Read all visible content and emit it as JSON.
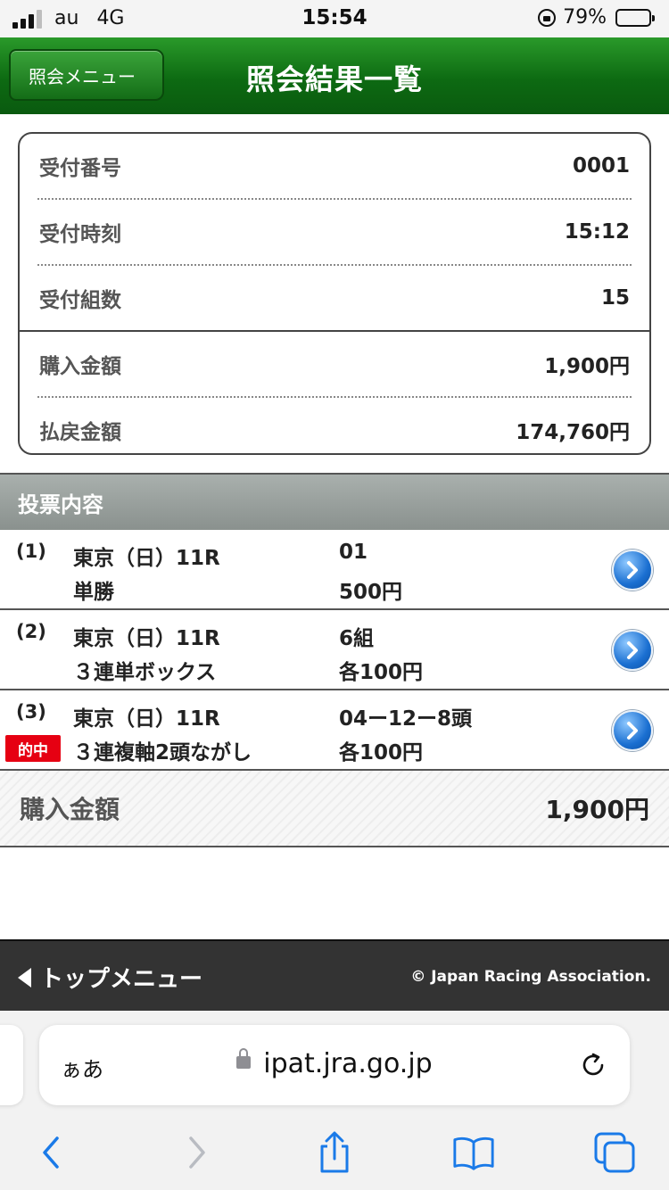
{
  "status_bar": {
    "carrier": "au",
    "network": "4G",
    "time": "15:54",
    "battery": "79%",
    "battery_level": 0.79
  },
  "header": {
    "back_label": "照会メニュー",
    "title": "照会結果一覧",
    "colors": {
      "header": "#0d6a12",
      "accent": "#1a6fd1",
      "hit": "#e60012"
    }
  },
  "summary": {
    "rows": [
      {
        "label": "受付番号",
        "value": "0001"
      },
      {
        "label": "受付時刻",
        "value": "15:12"
      },
      {
        "label": "受付組数",
        "value": "15"
      },
      {
        "label": "購入金額",
        "value": "1,900円"
      },
      {
        "label": "払戻金額",
        "value": "174,760円"
      }
    ]
  },
  "bets_section": {
    "title": "投票内容",
    "items": [
      {
        "num": "(1)",
        "venue": "東京（日）11R",
        "type": "単勝",
        "selection": "01",
        "amount": "500円",
        "hit": false
      },
      {
        "num": "(2)",
        "venue": "東京（日）11R",
        "type": "３連単ボックス",
        "selection": "6組",
        "amount": "各100円",
        "hit": false
      },
      {
        "num": "(3)",
        "venue": "東京（日）11R",
        "type": "３連複軸2頭ながし",
        "selection": "04ー12ー8頭",
        "amount": "各100円",
        "hit": true,
        "hit_label": "的中"
      }
    ]
  },
  "total": {
    "label": "購入金額",
    "value": "1,900円"
  },
  "footer": {
    "top_menu": "トップメニュー",
    "copyright": "© Japan Racing Association."
  },
  "browser": {
    "aa": "ぁあ",
    "url": "ipat.jra.go.jp",
    "icons": [
      "back-icon",
      "forward-icon",
      "share-icon",
      "bookmarks-icon",
      "tabs-icon",
      "reload-icon",
      "lock-icon"
    ]
  }
}
